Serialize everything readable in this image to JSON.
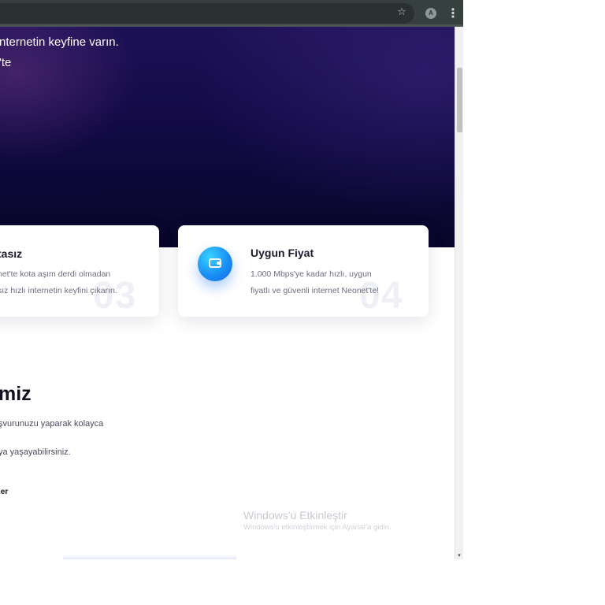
{
  "browser": {
    "star_icon": "☆",
    "avatar_letter": "A",
    "menu_icon": "⋮"
  },
  "hero": {
    "line1": "nternetin keyfine varın.",
    "line2": "'te"
  },
  "features": [
    {
      "number": "03",
      "title": "tasız",
      "line1": "net'te kota aşım derdi olmadan",
      "line2": "sız hızlı internetin keyfini çıkarın."
    },
    {
      "number": "04",
      "icon": "wallet-icon",
      "title": "Uygun Fiyat",
      "line1": "1.000 Mbps'ye kadar hızlı, uygun",
      "line2": "fiyatlı ve güvenli internet Neonet'te!"
    }
  ],
  "section": {
    "title": "miz",
    "line1": "şvurunuzu yaparak kolayca",
    "line2": "ya yaşayabilirsiniz.",
    "link": "ler"
  },
  "watermark": {
    "title": "Windows'u Etkinleştir",
    "subtitle": "Windows'u etkinleştirmek için Ayarlar'a gidin."
  },
  "colors": {
    "toolbar": "#36403f",
    "hero_dark": "#070628",
    "hero_purple": "#1d1156",
    "accent_blue": "#1a8ff5"
  },
  "scrollbar": {
    "down_arrow": "▾"
  }
}
